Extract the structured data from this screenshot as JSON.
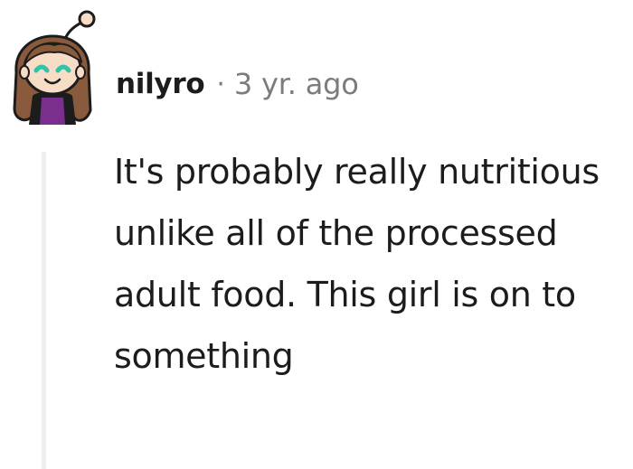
{
  "comment": {
    "username": "nilyro",
    "separator": "·",
    "timestamp": "3 yr. ago",
    "body": "It's probably really nutritious unlike all of the processed adult food. This girl is on to something",
    "avatar_icon": "snoo-avatar-icon",
    "colors": {
      "text": "#1c1c1c",
      "meta": "#7c7c7c",
      "thread_line": "#edeff1",
      "avatar_skin": "#f7dcc6",
      "avatar_hair": "#8a5a3c",
      "avatar_shirt": "#7a2f8f",
      "avatar_eyes": "#2fc4a8"
    }
  }
}
